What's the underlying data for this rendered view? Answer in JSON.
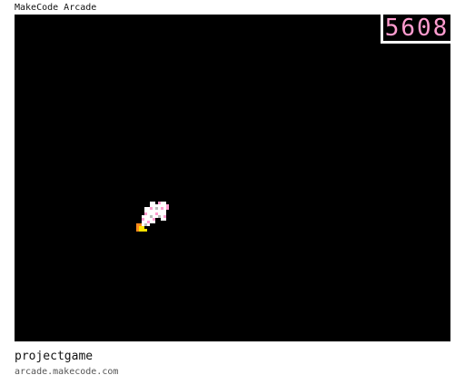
{
  "app": {
    "title": "MakeCode Arcade"
  },
  "game": {
    "score": "5608",
    "score_color": "#ff9ccf",
    "background_color": "#000000",
    "player_sprite_icon": "rocket-ship-icon"
  },
  "footer": {
    "project_name": "projectgame",
    "url": "arcade.makecode.com"
  }
}
